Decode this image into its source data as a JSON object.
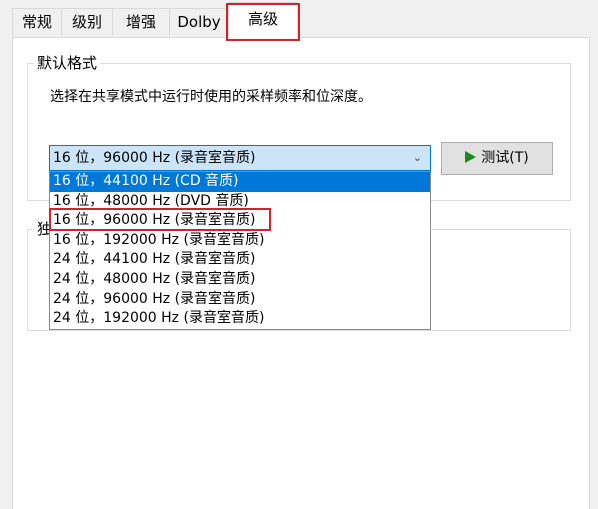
{
  "tabs": [
    {
      "label": "常规"
    },
    {
      "label": "级别"
    },
    {
      "label": "增强"
    },
    {
      "label": "Dolby"
    },
    {
      "label": "高级"
    }
  ],
  "default_format": {
    "group_label": "默认格式",
    "description": "选择在共享模式中运行时使用的采样频率和位深度。",
    "selected": "16 位，96000 Hz (录音室音质)",
    "options": [
      "16 位，44100 Hz (CD 音质)",
      "16 位，48000 Hz (DVD 音质)",
      "16 位，96000 Hz (录音室音质)",
      "16 位，192000 Hz (录音室音质)",
      "24 位，44100 Hz (录音室音质)",
      "24 位，48000 Hz (录音室音质)",
      "24 位，96000 Hz (录音室音质)",
      "24 位，192000 Hz (录音室音质)"
    ],
    "test_button": "测试(T)"
  },
  "exclusive_mode": {
    "group_label": "独"
  },
  "colors": {
    "highlight_red": "#d3232a",
    "selection_blue": "#0078d7"
  }
}
